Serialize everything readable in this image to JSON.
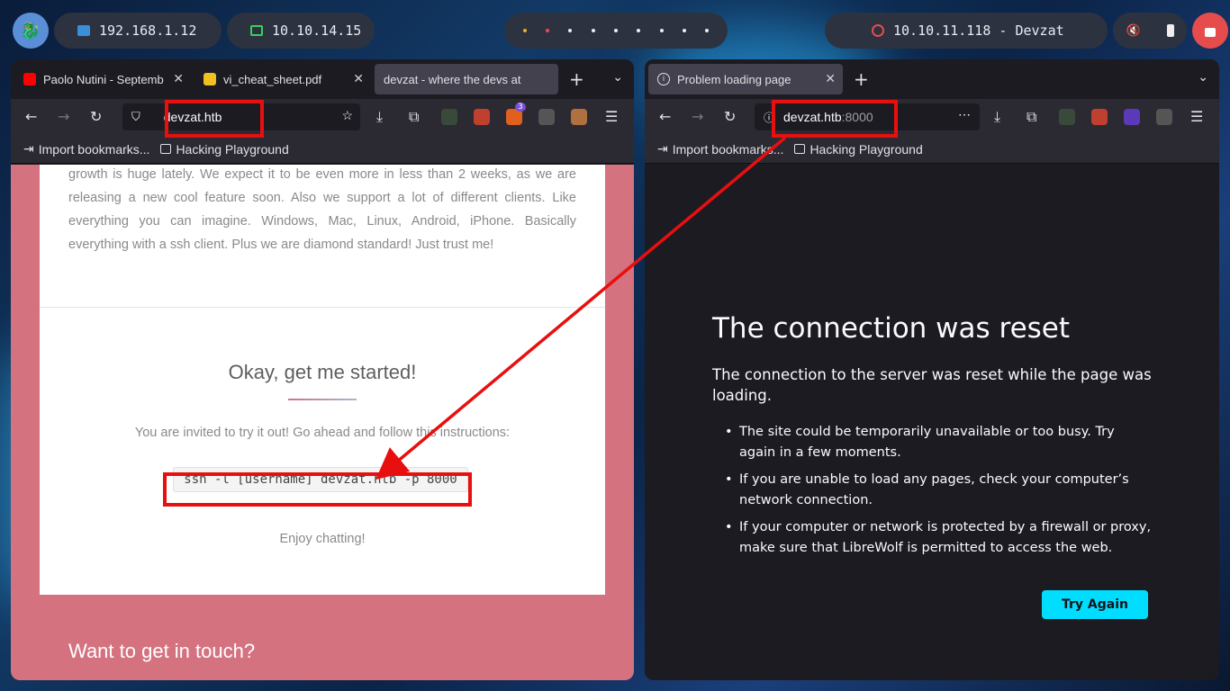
{
  "topbar": {
    "ip_local": "192.168.1.12",
    "ip_vpn": "10.10.14.15",
    "target": "10.10.11.118 - Devzat"
  },
  "left_browser": {
    "tabs": [
      {
        "label": "Paolo Nutini - Septemb",
        "favicon_color": "#ff0000"
      },
      {
        "label": "vi_cheat_sheet.pdf",
        "favicon_color": "#f0c020"
      },
      {
        "label": "devzat - where the devs at",
        "favicon_color": ""
      }
    ],
    "url": "devzat.htb",
    "bookmarks": [
      "Import bookmarks...",
      "Hacking Playground"
    ],
    "badge_count": "3",
    "page": {
      "paragraph": "growth is huge lately. We expect it to be even more in less than 2 weeks, as we are releasing a new cool feature soon. Also we support a lot of different clients. Like everything you can imagine. Windows, Mac, Linux, Android, iPhone. Basically everything with a ssh client. Plus we are diamond standard! Just trust me!",
      "heading": "Okay, get me started!",
      "invite": "You are invited to try it out! Go ahead and follow this instructions:",
      "command": "ssh -l [username] devzat.htb -p 8000",
      "enjoy": "Enjoy chatting!",
      "touch": "Want to get in touch?"
    }
  },
  "right_browser": {
    "tab": "Problem loading page",
    "url_host": "devzat.htb",
    "url_port": ":8000",
    "bookmarks": [
      "Import bookmarks...",
      "Hacking Playground"
    ],
    "error": {
      "title": "The connection was reset",
      "description": "The connection to the server was reset while the page was loading.",
      "items": [
        "The site could be temporarily unavailable or too busy. Try again in a few moments.",
        "If you are unable to load any pages, check your computer’s network connection.",
        "If your computer or network is protected by a firewall or proxy, make sure that LibreWolf is permitted to access the web."
      ],
      "button": "Try Again"
    }
  },
  "colors": {
    "accent": "#00ddff",
    "annotation": "#e80f0f",
    "page_bg": "#d47280"
  }
}
